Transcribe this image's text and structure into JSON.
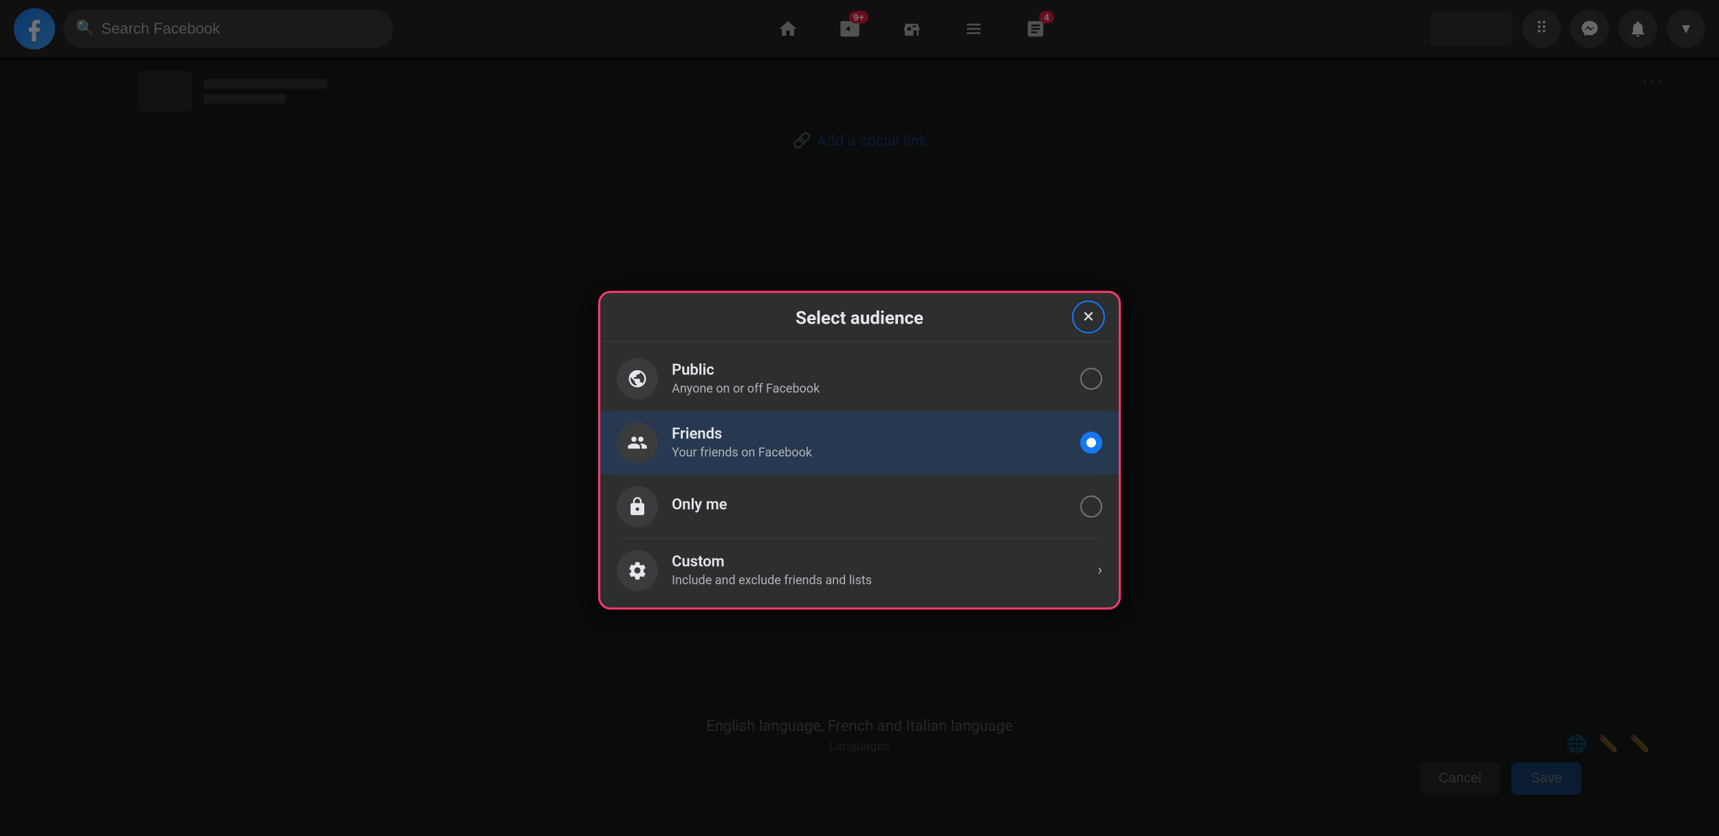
{
  "navbar": {
    "logo_letter": "f",
    "search_placeholder": "Search Facebook",
    "nav_icons": [
      {
        "name": "home-icon",
        "symbol": "⌂",
        "badge": null
      },
      {
        "name": "video-icon",
        "symbol": "▶",
        "badge": "9+"
      },
      {
        "name": "marketplace-icon",
        "symbol": "🛒",
        "badge": null
      },
      {
        "name": "groups-icon",
        "symbol": "⊞",
        "badge": null
      },
      {
        "name": "news-icon",
        "symbol": "📰",
        "badge": "4"
      }
    ],
    "right_icons": [
      {
        "name": "grid-icon",
        "symbol": "⠿"
      },
      {
        "name": "messenger-icon",
        "symbol": "✉"
      },
      {
        "name": "bell-icon",
        "symbol": "🔔"
      },
      {
        "name": "chevron-down-icon",
        "symbol": "▾"
      }
    ]
  },
  "background": {
    "social_link_text": "Add a social link",
    "dots_text": "···",
    "languages_text": "English language, French and Italian language",
    "languages_label": "Languages",
    "cancel_label": "Cancel",
    "save_label": "Save"
  },
  "modal": {
    "title": "Select audience",
    "close_label": "✕",
    "options": [
      {
        "id": "public",
        "icon": "🌐",
        "label": "Public",
        "sublabel": "Anyone on or off Facebook",
        "type": "radio",
        "selected": false
      },
      {
        "id": "friends",
        "icon": "👥",
        "label": "Friends",
        "sublabel": "Your friends on Facebook",
        "type": "radio",
        "selected": true
      },
      {
        "id": "only-me",
        "icon": "🔒",
        "label": "Only me",
        "sublabel": "",
        "type": "radio",
        "selected": false
      },
      {
        "id": "custom",
        "icon": "⚙",
        "label": "Custom",
        "sublabel": "Include and exclude friends and lists",
        "type": "chevron",
        "selected": false
      }
    ]
  },
  "colors": {
    "accent_blue": "#1877f2",
    "selected_bg": "#263951",
    "border_pink": "#ff3b6e",
    "dark_bg": "#2d2e2f",
    "darker_bg": "#18191a",
    "text_primary": "#e4e6eb",
    "text_secondary": "#b0b3b8"
  }
}
